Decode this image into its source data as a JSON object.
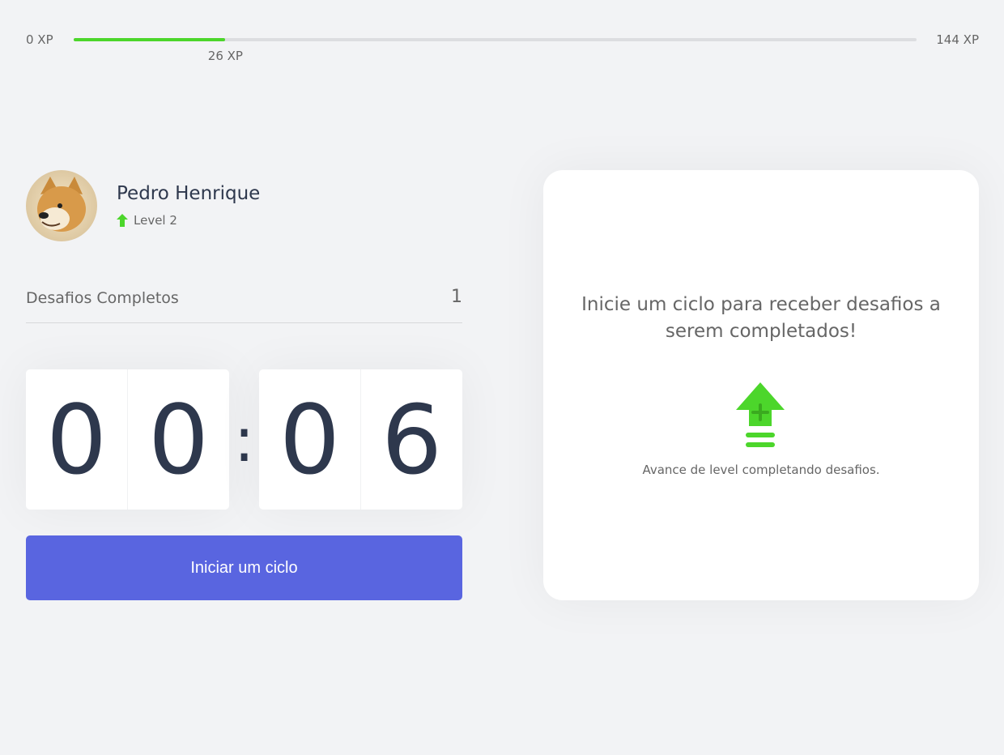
{
  "xp": {
    "min_label": "0 XP",
    "max_label": "144 XP",
    "current_label": "26 XP",
    "progress": 0.18,
    "color": "#4cd62b"
  },
  "profile": {
    "name": "Pedro Henrique",
    "level_label": "Level 2",
    "level_icon": "level-up-arrow-icon",
    "avatar": "shiba-inu-avatar"
  },
  "challenges": {
    "label": "Desafios Completos",
    "count": "1"
  },
  "countdown": {
    "minute_left": "0",
    "minute_right": "0",
    "separator": ":",
    "second_left": "0",
    "second_right": "6"
  },
  "start_button": {
    "label": "Iniciar um ciclo",
    "color": "#5965e0"
  },
  "challenge_card": {
    "message": "Inicie um ciclo para receber desafios a serem completados!",
    "icon": "level-up-icon",
    "hint": "Avance de level completando desafios."
  }
}
